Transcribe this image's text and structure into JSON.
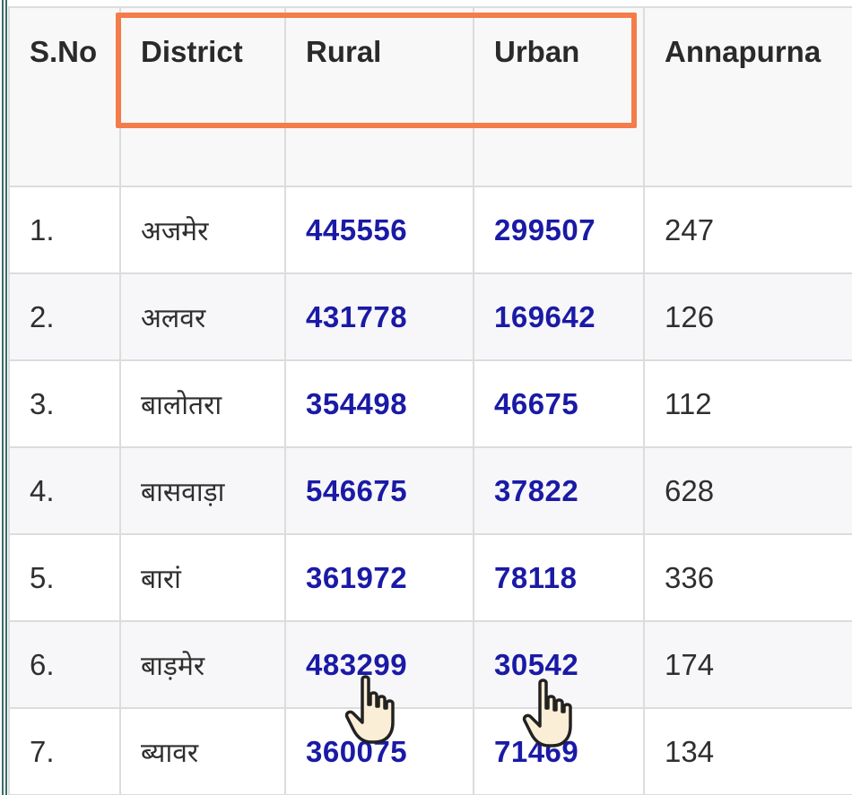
{
  "table": {
    "headers": {
      "sno": "S.No",
      "district": "District",
      "rural": "Rural",
      "urban": "Urban",
      "annapurna": "Annapurna"
    },
    "rows": [
      {
        "sno": "1.",
        "district": "अजमेर",
        "rural": "445556",
        "urban": "299507",
        "annapurna": "247"
      },
      {
        "sno": "2.",
        "district": "अलवर",
        "rural": "431778",
        "urban": "169642",
        "annapurna": "126"
      },
      {
        "sno": "3.",
        "district": "बालोतरा",
        "rural": "354498",
        "urban": "46675",
        "annapurna": "112"
      },
      {
        "sno": "4.",
        "district": "बासवाड़ा",
        "rural": "546675",
        "urban": "37822",
        "annapurna": "628"
      },
      {
        "sno": "5.",
        "district": "बारां",
        "rural": "361972",
        "urban": "78118",
        "annapurna": "336"
      },
      {
        "sno": "6.",
        "district": "बाड़मेर",
        "rural": "483299",
        "urban": "30542",
        "annapurna": "174"
      },
      {
        "sno": "7.",
        "district": "ब्यावर",
        "rural": "360075",
        "urban": "71469",
        "annapurna": "134"
      }
    ]
  },
  "colors": {
    "link_number": "#1a1aa6",
    "highlight": "#f47c4a",
    "border": "#dcdcdc"
  },
  "annotations": {
    "highlight_icon": "rectangle-highlight",
    "pointer_icon": "hand-pointer-icon"
  }
}
